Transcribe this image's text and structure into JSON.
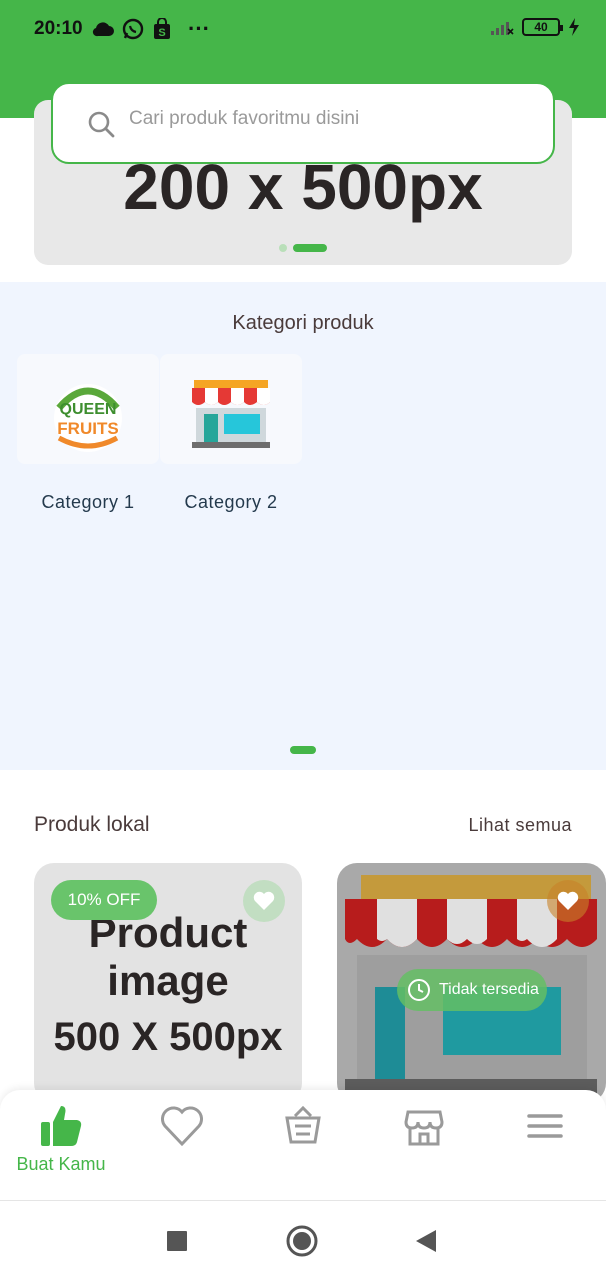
{
  "status": {
    "time": "20:10",
    "battery": "40",
    "dots": "···"
  },
  "search": {
    "placeholder": "Cari produk favoritmu disini"
  },
  "banner": {
    "text": "200 x 500px"
  },
  "categories": {
    "title": "Kategori produk",
    "items": [
      {
        "label": "Category 1",
        "logo_text_1": "QUEEN",
        "logo_text_2": "FRUITS"
      },
      {
        "label": "Category 2"
      }
    ]
  },
  "products": {
    "title": "Produk lokal",
    "see_all": "Lihat semua",
    "cards": [
      {
        "badge": "10% OFF",
        "image_text_1": "Product",
        "image_text_2": "image",
        "image_text_3": "500 X 500px"
      },
      {
        "status": "Tidak tersedia"
      }
    ]
  },
  "bottom_nav": {
    "items": [
      {
        "label": "Buat Kamu",
        "icon": "thumbs-up-icon",
        "active": true
      },
      {
        "icon": "heart-icon"
      },
      {
        "icon": "basket-icon"
      },
      {
        "icon": "store-icon"
      },
      {
        "icon": "menu-icon"
      }
    ]
  },
  "colors": {
    "primary": "#45b649",
    "category_bg": "#f0f5fe",
    "text": "#4a3b3b"
  }
}
